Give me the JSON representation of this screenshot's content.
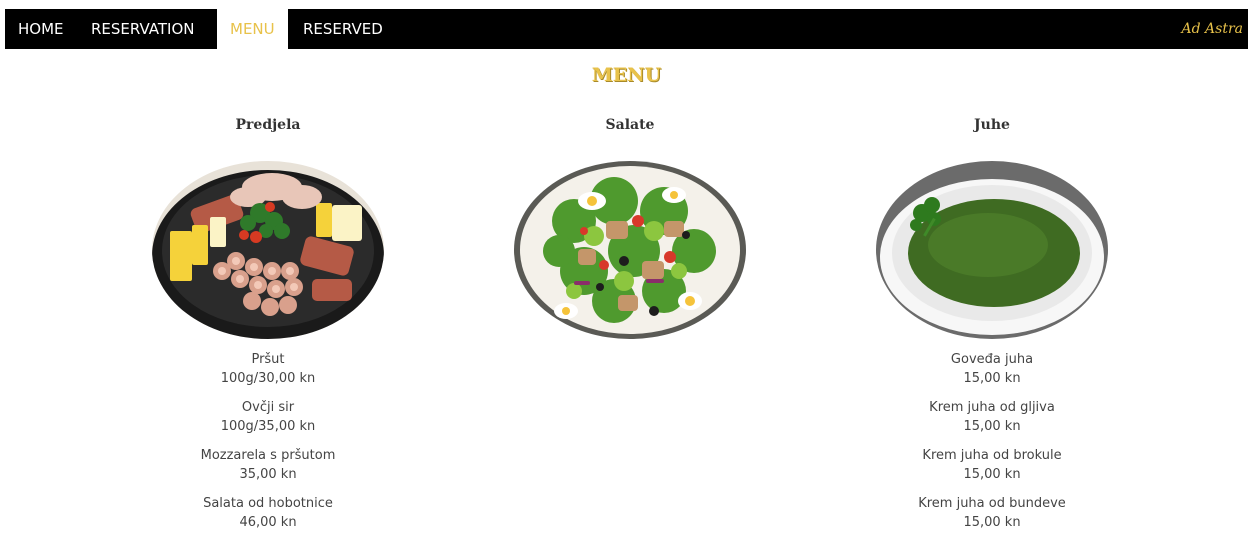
{
  "nav": {
    "items": [
      {
        "label": "HOME"
      },
      {
        "label": "RESERVATION"
      },
      {
        "label": "MENU"
      },
      {
        "label": "RESERVED"
      }
    ],
    "brand": "Ad Astra",
    "active_color": "#e8c24a"
  },
  "page": {
    "title": "MENU"
  },
  "columns": [
    {
      "heading": "Predjela",
      "image_icon": "cold-cuts-platter",
      "items": [
        {
          "name": "Pršut",
          "price": "100g/30,00 kn"
        },
        {
          "name": "Ovčji sir",
          "price": "100g/35,00 kn"
        },
        {
          "name": "Mozzarela s pršutom",
          "price": "35,00 kn"
        },
        {
          "name": "Salata od hobotnice",
          "price": "46,00 kn"
        }
      ]
    },
    {
      "heading": "Salate",
      "image_icon": "tuna-salad",
      "items": []
    },
    {
      "heading": "Juhe",
      "image_icon": "green-soup-bowl",
      "items": [
        {
          "name": "Goveđa juha",
          "price": "15,00 kn"
        },
        {
          "name": "Krem juha od gljiva",
          "price": "15,00 kn"
        },
        {
          "name": "Krem juha od brokule",
          "price": "15,00 kn"
        },
        {
          "name": "Krem juha od bundeve",
          "price": "15,00 kn"
        }
      ]
    }
  ]
}
